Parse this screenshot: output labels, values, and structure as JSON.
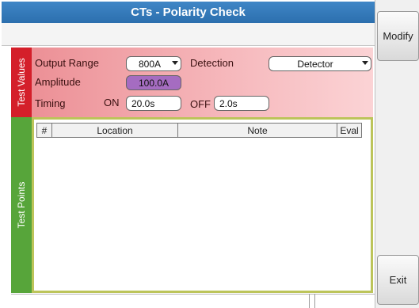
{
  "title": "CTs - Polarity Check",
  "side_buttons": {
    "modify": "Modify",
    "exit": "Exit"
  },
  "test_values": {
    "tab_label": "Test Values",
    "output_range_label": "Output Range",
    "output_range_value": "800A",
    "detection_label": "Detection",
    "detection_value": "Detector",
    "amplitude_label": "Amplitude",
    "amplitude_value": "100.0A",
    "timing_label": "Timing",
    "on_label": "ON",
    "on_value": "20.0s",
    "off_label": "OFF",
    "off_value": "2.0s"
  },
  "test_points": {
    "tab_label": "Test Points",
    "columns": [
      "#",
      "Location",
      "Note",
      "Eval"
    ],
    "rows": []
  },
  "colors": {
    "title_bar": "#2f74b5",
    "test_values_tab": "#d41f2a",
    "test_points_tab": "#57a53a",
    "amplitude_field": "#a56cc1"
  }
}
